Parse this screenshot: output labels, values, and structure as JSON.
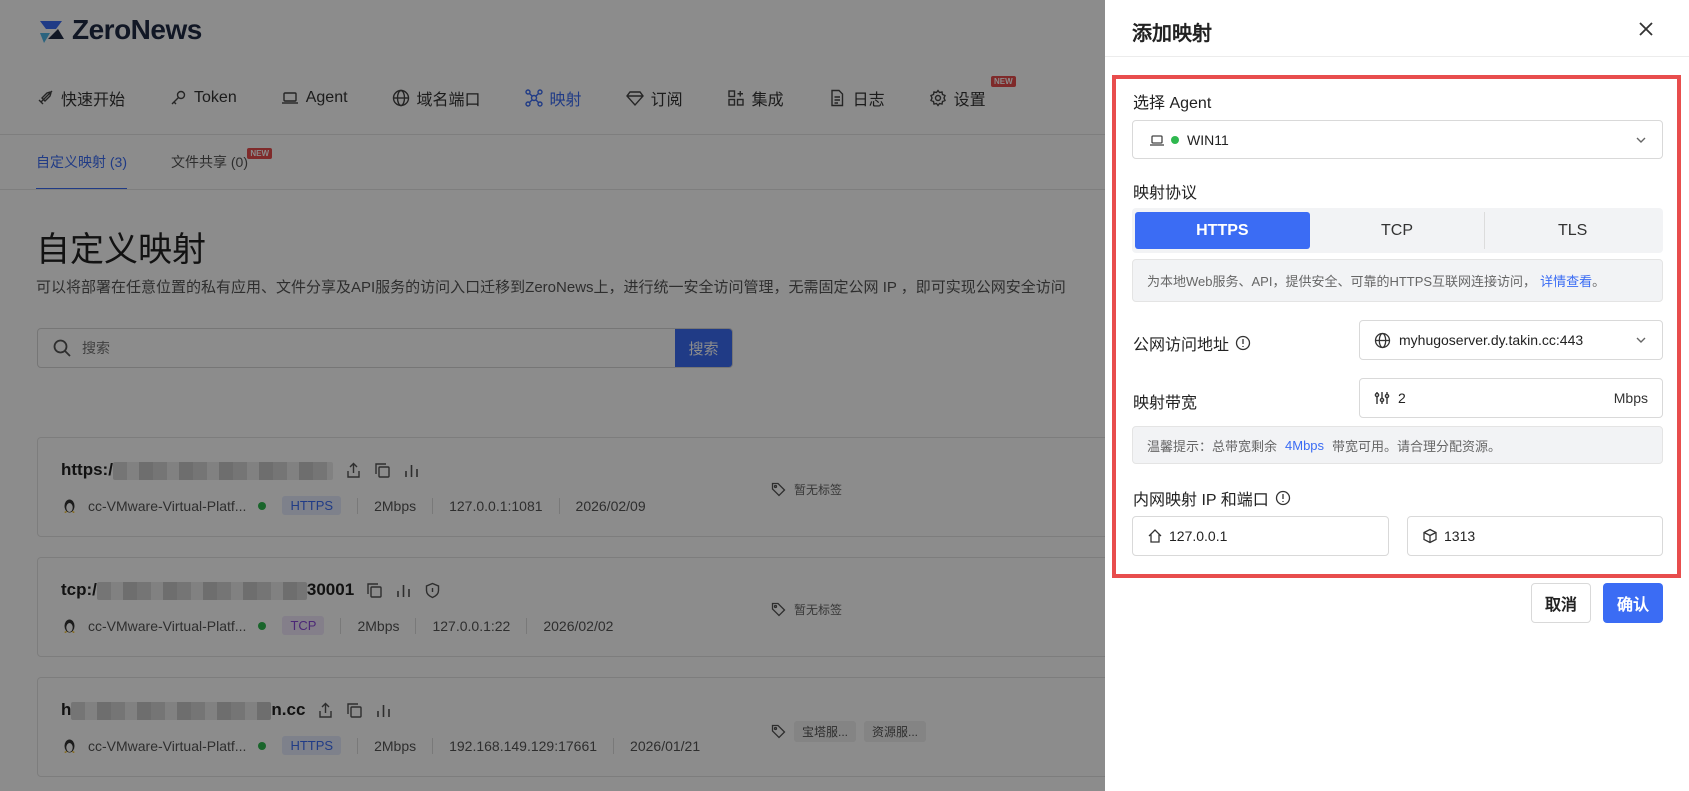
{
  "app": {
    "logo_text": "ZeroNews"
  },
  "nav": {
    "items": [
      {
        "label": "快速开始",
        "icon": "rocket-icon"
      },
      {
        "label": "Token",
        "icon": "key-icon"
      },
      {
        "label": "Agent",
        "icon": "laptop-icon"
      },
      {
        "label": "域名端口",
        "icon": "globe-icon"
      },
      {
        "label": "映射",
        "icon": "network-icon"
      },
      {
        "label": "订阅",
        "icon": "diamond-icon"
      },
      {
        "label": "集成",
        "icon": "grid-icon"
      },
      {
        "label": "日志",
        "icon": "document-icon"
      },
      {
        "label": "设置",
        "icon": "gear-icon"
      }
    ],
    "new_badge": "NEW"
  },
  "subtabs": [
    {
      "label": "自定义映射 (3)"
    },
    {
      "label": "文件共享 (0)"
    }
  ],
  "page": {
    "title": "自定义映射",
    "description": "可以将部署在任意位置的私有应用、文件分享及API服务的访问入口迁移到ZeroNews上，进行统一安全访问管理，无需固定公网 IP ，即可实现公网安全访问"
  },
  "search": {
    "placeholder": "搜索",
    "button": "搜索"
  },
  "cards": [
    {
      "url_prefix": "https:/",
      "url_suffix": "",
      "agent": "cc-VMware-Virtual-Platf...",
      "protocol": "HTTPS",
      "bandwidth": "2Mbps",
      "target": "127.0.0.1:1081",
      "date": "2026/02/09",
      "tags": [
        "暂无标签"
      ]
    },
    {
      "url_prefix": "tcp:/",
      "url_suffix": "30001",
      "agent": "cc-VMware-Virtual-Platf...",
      "protocol": "TCP",
      "bandwidth": "2Mbps",
      "target": "127.0.0.1:22",
      "date": "2026/02/02",
      "tags": [
        "暂无标签"
      ]
    },
    {
      "url_prefix": "h",
      "url_suffix": "n.cc",
      "agent": "cc-VMware-Virtual-Platf...",
      "protocol": "HTTPS",
      "bandwidth": "2Mbps",
      "target": "192.168.149.129:17661",
      "date": "2026/01/21",
      "tags": [
        "宝塔服...",
        "资源服..."
      ]
    }
  ],
  "drawer": {
    "title": "添加映射",
    "agent_label": "选择 Agent",
    "agent_value": "WIN11",
    "protocol_label": "映射协议",
    "protocols": [
      "HTTPS",
      "TCP",
      "TLS"
    ],
    "protocol_selected": "HTTPS",
    "protocol_hint": "为本地Web服务、API，提供安全、可靠的HTTPS互联网连接访问，",
    "protocol_hint_link": "详情查看",
    "protocol_hint_end": "。",
    "domain_label": "公网访问地址",
    "domain_value": "myhugoserver.dy.takin.cc:443",
    "bandwidth_label": "映射带宽",
    "bandwidth_value": "2",
    "bandwidth_unit": "Mbps",
    "tip_prefix": "温馨提示：总带宽剩余",
    "tip_value": "4Mbps",
    "tip_suffix": "带宽可用。请合理分配资源。",
    "ip_label": "内网映射 IP 和端口",
    "ip_value": "127.0.0.1",
    "port_value": "1313",
    "cancel": "取消",
    "confirm": "确认"
  },
  "colors": {
    "accent": "#3b6cf4",
    "highlight": "#e84d4d",
    "online": "#2fb84f"
  }
}
